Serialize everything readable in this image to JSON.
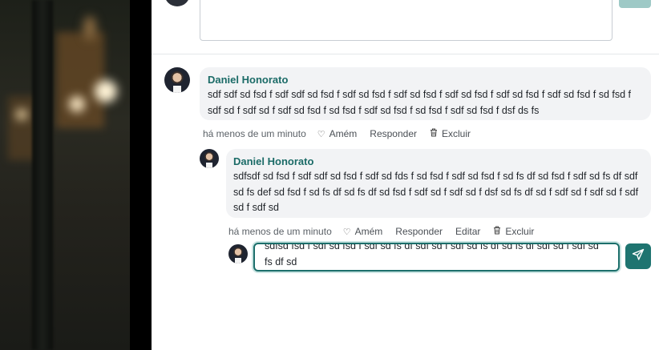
{
  "comments": [
    {
      "author": "Daniel Honorato",
      "text": "sdf sdf sd fsd f sdf sdf sd fsd f sdf sd fsd f sdf sd fsd f sdf sd fsd f sdf sd fsd f sdf sd fsd f sd fsd f sdf sd f sdf sd f sdf sd fsd f sd fsd f sdf sd fsd f sd fsd f sdf sd fsd f dsf ds fs",
      "time": "há menos de um minuto",
      "actions": {
        "like": "Amém",
        "reply": "Responder",
        "delete": "Excluir"
      }
    },
    {
      "author": "Daniel Honorato",
      "text": "sdfsdf sd fsd f sdf sdf sd fsd f sdf sd fds f sd fsd f sdf sd fsd f sd fs df sd fsd f sdf sd fs df sdf sd fs def sd fsd f sd fs df sd fs df sd fsd f sdf sd f sdf sd f dsf sd fs df sd f sdf sd f sdf sd f sdf sd f sdf sd",
      "time": "há menos de um minuto",
      "actions": {
        "like": "Amém",
        "reply": "Responder",
        "edit": "Editar",
        "delete": "Excluir"
      }
    }
  ],
  "reply_input": {
    "value": "sdfsd fsd f sdf sd fsd f sdf sd fs df sdf sd f sdf sd fs df sd fs df sdf sd f sdf sd fs df sd"
  },
  "icons": {
    "like": "heart-outline-icon",
    "delete": "trash-icon",
    "send": "send-icon"
  },
  "colors": {
    "accent": "#1e7470",
    "author": "#1b6b67",
    "bubble": "#f2f3f5"
  }
}
